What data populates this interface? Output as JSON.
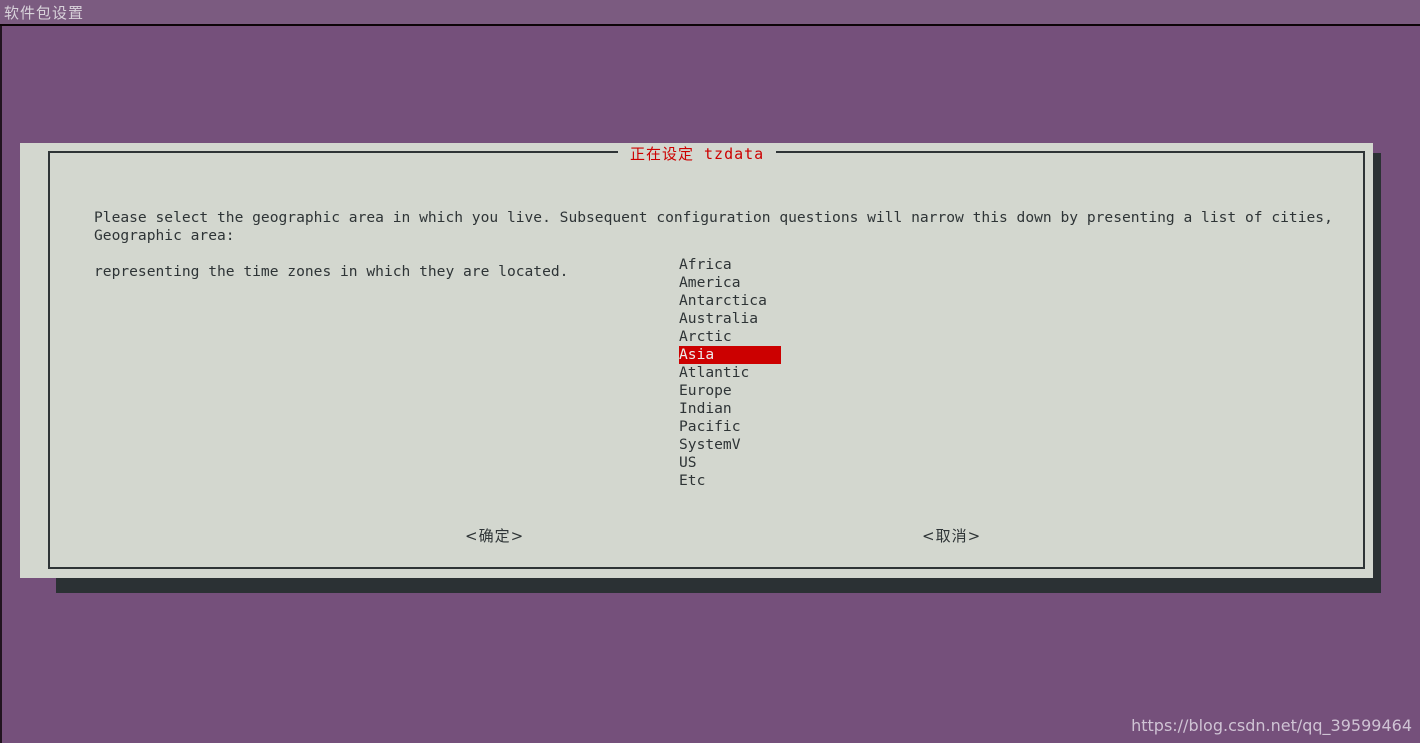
{
  "window": {
    "title": "软件包设置"
  },
  "dialog": {
    "title": "正在设定 tzdata",
    "title_color": "#cc0000",
    "description_line1": "Please select the geographic area in which you live. Subsequent configuration questions will narrow this down by presenting a list of cities,",
    "description_line2": "representing the time zones in which they are located.",
    "field_label": "Geographic area:",
    "list": {
      "items": [
        "Africa",
        "America",
        "Antarctica",
        "Australia",
        "Arctic",
        "Asia",
        "Atlantic",
        "Europe",
        "Indian",
        "Pacific",
        "SystemV",
        "US",
        "Etc"
      ],
      "selected_index": 5,
      "selected_value": "Asia",
      "highlight_bg": "#cc0000",
      "highlight_fg": "#eeeeec"
    },
    "buttons": {
      "ok": "<确定>",
      "cancel": "<取消>"
    }
  },
  "watermark": {
    "text": "https://blog.csdn.net/qq_39599464"
  },
  "colors": {
    "desktop_background": "#75507b",
    "titlebar_background": "#7b5b80",
    "dialog_background": "#d3d7cf",
    "dialog_border": "#2e3436",
    "shadow": "#2b3134",
    "text": "#2e3436"
  }
}
